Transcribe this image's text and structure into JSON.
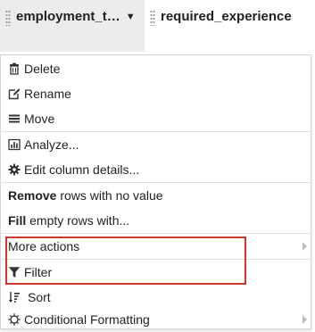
{
  "header": {
    "active_column": "employment_t…",
    "next_column": "required_experience"
  },
  "menu": {
    "delete": "Delete",
    "rename": "Rename",
    "move": "Move",
    "analyze": "Analyze...",
    "edit_details": "Edit column details...",
    "remove_bold": "Remove",
    "remove_rest": " rows with no value",
    "fill_bold": "Fill",
    "fill_rest": " empty rows with...",
    "more_actions": "More actions",
    "filter": "Filter",
    "sort": "Sort",
    "conditional_formatting": "Conditional Formatting"
  },
  "colors": {
    "highlight": "#d0382c",
    "header_active": "#ececec"
  },
  "icons": {
    "delete": "trash-icon",
    "rename": "edit-icon",
    "move": "bars-icon",
    "analyze": "bar-chart-icon",
    "edit_details": "gear-icon",
    "filter": "filter-icon",
    "sort": "sort-icon",
    "conditional_formatting": "sun-icon"
  }
}
